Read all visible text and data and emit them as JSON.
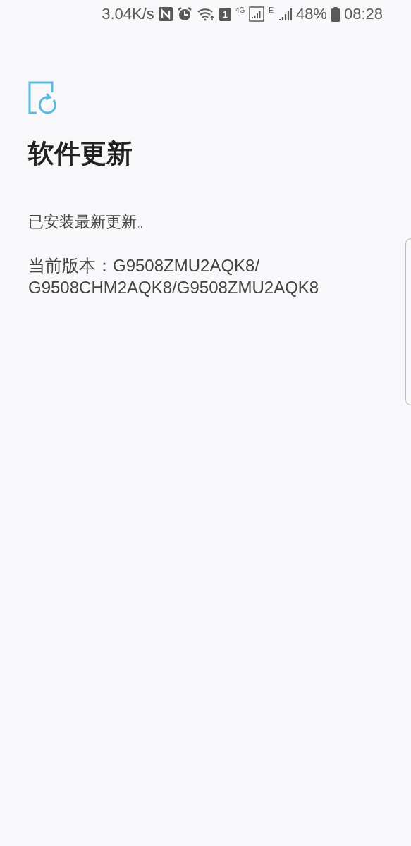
{
  "status_bar": {
    "net_speed": "3.04K/s",
    "sim_slot": "1",
    "network_type": "4G",
    "second_network_type": "E",
    "battery": "48%",
    "time": "08:28"
  },
  "title": "软件更新",
  "message": "已安装最新更新。",
  "version": "当前版本：G9508ZMU2AQK8/G9508CHM2AQK8/G9508ZMU2AQK8"
}
